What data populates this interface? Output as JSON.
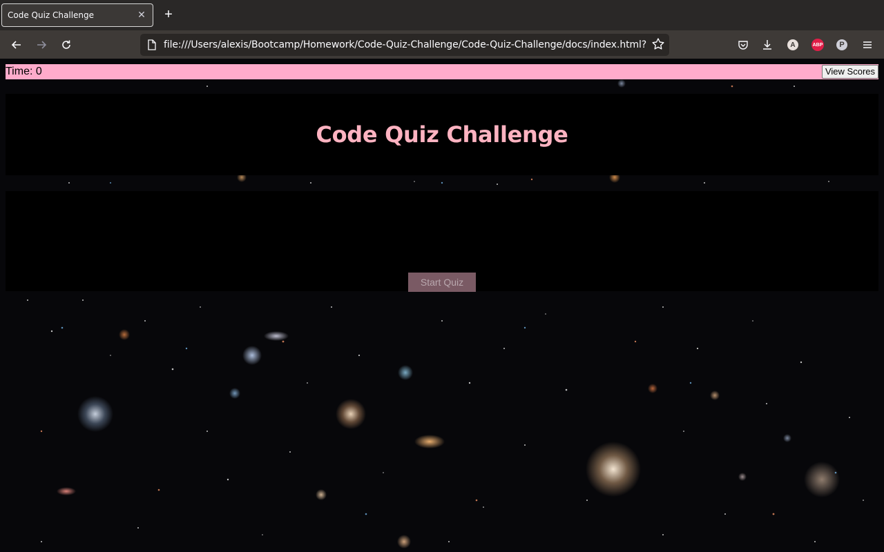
{
  "browser": {
    "tab": {
      "title": "Code Quiz Challenge",
      "close_icon": "close-icon"
    },
    "new_tab_icon": "plus-icon",
    "nav": {
      "back_icon": "arrow-left-icon",
      "forward_icon": "arrow-right-icon",
      "reload_icon": "reload-icon"
    },
    "url": "file:///Users/alexis/Bootcamp/Homework/Code-Quiz-Challenge/Code-Quiz-Challenge/docs/index.html?",
    "extensions": {
      "avatar_letter": "A",
      "abp_label": "ABP",
      "p_label": "P"
    }
  },
  "page": {
    "timer": {
      "label": "Time: 0"
    },
    "view_scores_label": "View Scores",
    "title": "Code Quiz Challenge",
    "start_button_label": "Start Quiz"
  },
  "colors": {
    "timer_bar": "#ffabcb",
    "title": "#ffb3c1",
    "start_button": "#7a5a64"
  }
}
